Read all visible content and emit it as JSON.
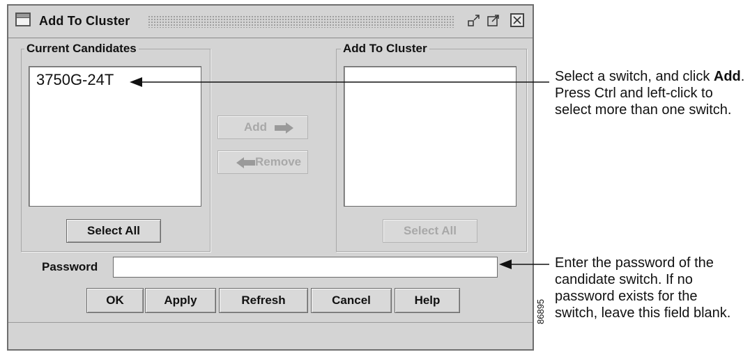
{
  "window": {
    "title": "Add To Cluster",
    "icons": [
      "window-icon",
      "minimize-icon",
      "maximize-icon",
      "close-icon"
    ]
  },
  "current_candidates": {
    "label": "Current Candidates",
    "items": [
      "3750G-24T"
    ],
    "select_all_label": "Select All"
  },
  "add_to_cluster": {
    "label": "Add To Cluster",
    "items": [],
    "select_all_label": "Select All"
  },
  "transfer": {
    "add_label": "Add",
    "remove_label": "Remove"
  },
  "password": {
    "label": "Password",
    "value": ""
  },
  "buttons": {
    "ok": "OK",
    "apply": "Apply",
    "refresh": "Refresh",
    "cancel": "Cancel",
    "help": "Help"
  },
  "callouts": {
    "select": {
      "pre": "Select a switch, and click ",
      "bold": "Add",
      "post": ". Press Ctrl and left-click to select more than one switch."
    },
    "password": "Enter the password of the candidate switch. If no password exists for the switch, leave this field blank."
  },
  "figure_id": "86895",
  "colors": {
    "dialog_bg": "#d4d4d4",
    "disabled_text": "#a8a8a8",
    "arrow_gray": "#9a9a9a"
  }
}
